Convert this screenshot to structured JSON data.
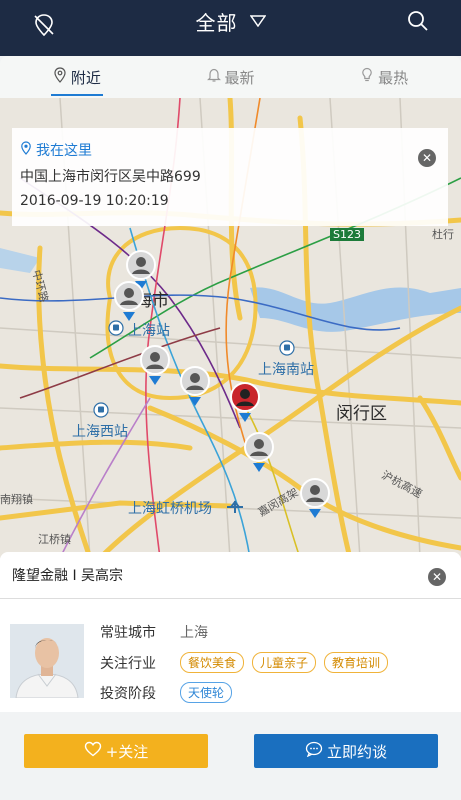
{
  "topbar": {
    "title": "全部",
    "left_icon": "map-pin-slash-icon",
    "search_icon": "search-icon"
  },
  "tabs": [
    {
      "label": "附近",
      "icon": "location-icon",
      "active": true
    },
    {
      "label": "最新",
      "icon": "bell-icon",
      "active": false
    },
    {
      "label": "最热",
      "icon": "bulb-icon",
      "active": false
    }
  ],
  "map": {
    "labels": {
      "city": "海市",
      "shanghai_station": "上海站",
      "shanghai_south": "上海南站",
      "minhang": "闵行区",
      "shanghai_west": "上海西站",
      "hongqiao": "上海虹桥机场",
      "nanxiang": "南翔镇",
      "jiangqiao": "江桥镇",
      "huhang": "沪杭高速",
      "jiamin": "嘉闵高架",
      "s123": "S123",
      "du": "杜行",
      "zhuanghuan": "中环路"
    },
    "location_card": {
      "title": "我在这里",
      "address": "中国上海市闵行区吴中路699",
      "time": "2016-09-19 10:20:19"
    }
  },
  "profile": {
    "header": "隆望金融 I 吴高宗",
    "city_label": "常驻城市",
    "city_value": "上海",
    "industry_label": "关注行业",
    "industries": [
      "餐饮美食",
      "儿童亲子",
      "教育培训"
    ],
    "stage_label": "投资阶段",
    "stage_value": "天使轮"
  },
  "actions": {
    "follow": "+关注",
    "chat": "立即约谈"
  },
  "colors": {
    "navbar": "#1d2b44",
    "accent_blue": "#1e7bd3",
    "follow_button": "#f3b11e",
    "chat_button": "#1a6fbf",
    "selected_pin": "#c9252c"
  }
}
